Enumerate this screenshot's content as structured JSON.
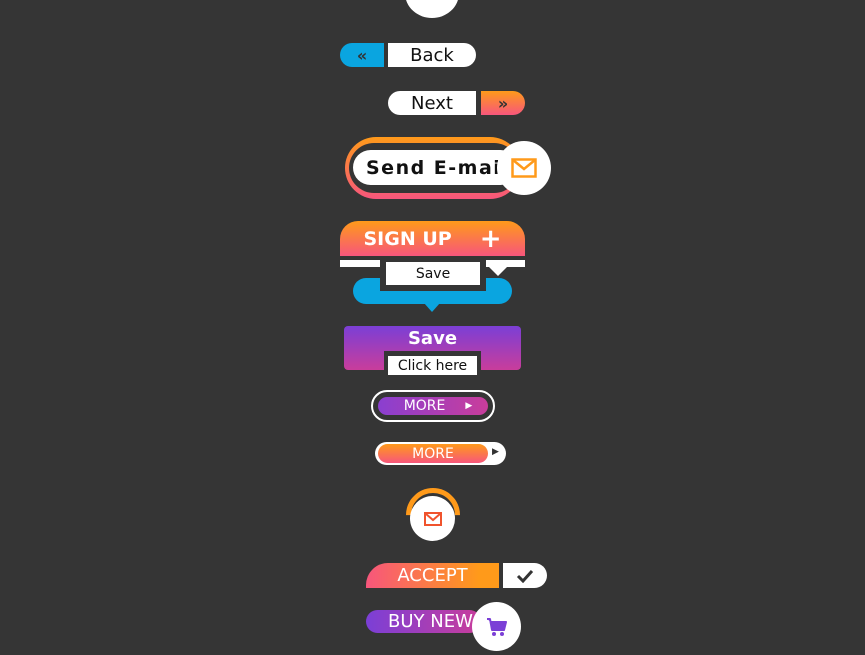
{
  "buttons": {
    "back": {
      "label": "Back",
      "icon": "chevrons-left-icon"
    },
    "next": {
      "label": "Next",
      "icon": "chevrons-right-icon"
    },
    "send_email": {
      "label": "Send E-mail",
      "icon": "envelope-icon"
    },
    "sign_up": {
      "label": "SIGN UP",
      "icon": "plus-icon"
    },
    "tooltip_save": {
      "label": "Save"
    },
    "save": {
      "label": "Save",
      "tooltip": "Click here"
    },
    "more_purple": {
      "label": "MORE",
      "icon": "play-icon"
    },
    "more_orange": {
      "label": "MORE",
      "icon": "play-icon"
    },
    "mail_round": {
      "icon": "envelope-icon"
    },
    "accept": {
      "label": "ACCEPT",
      "icon": "check-icon"
    },
    "buy_new": {
      "label": "BUY NEW",
      "icon": "cart-icon"
    }
  },
  "colors": {
    "blue": "#0aa5e0",
    "orange": "#ff9a1a",
    "pink": "#f7567c",
    "purple": "#7b3fd6",
    "magenta": "#c93d9b",
    "background": "#353535"
  }
}
